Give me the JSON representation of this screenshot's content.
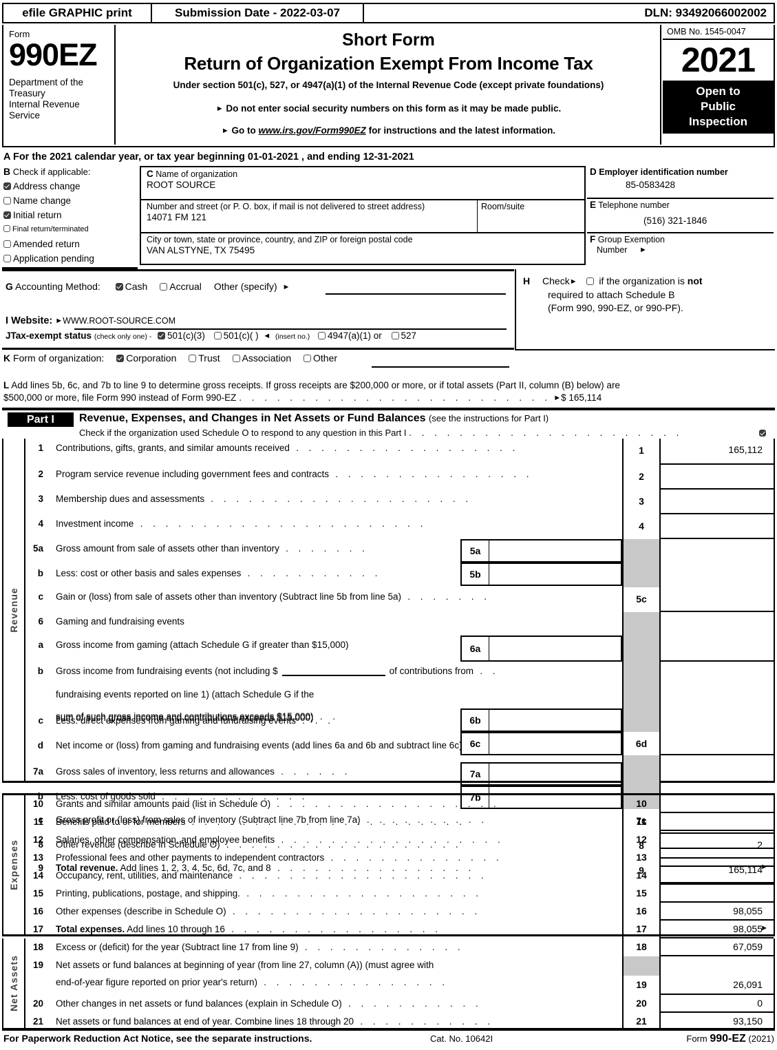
{
  "topbar": {
    "efile_label": "efile GRAPHIC print",
    "submission_label": "Submission Date - 2022-03-07",
    "dln_label": "DLN: 93492066002002"
  },
  "masthead": {
    "form_word": "Form",
    "form_number": "990EZ",
    "agency": "Department of the\nTreasury\nInternal Revenue\nService",
    "title": "Short Form",
    "subtitle": "Return of Organization Exempt From Income Tax",
    "under_section": "Under section 501(c), 527, or 4947(a)(1) of the Internal Revenue Code (except private foundations)",
    "note1": "Do not enter social security numbers on this form as it may be made public.",
    "note2_pre": "Go to ",
    "note2_link": "www.irs.gov/Form990EZ",
    "note2_post": " for instructions and the latest information.",
    "omb": "OMB No. 1545-0047",
    "year": "2021",
    "open_to": "Open to\nPublic\nInspection"
  },
  "line_a": "A  For the 2021 calendar year, or tax year beginning 01-01-2021 , and ending 12-31-2021",
  "section_b": {
    "key": "B",
    "title": "Check if applicable:",
    "options": [
      {
        "label": "Address change",
        "checked": true,
        "small": false
      },
      {
        "label": "Name change",
        "checked": false,
        "small": false
      },
      {
        "label": "Initial return",
        "checked": true,
        "small": false
      },
      {
        "label": "Final return/terminated",
        "checked": false,
        "small": true
      },
      {
        "label": "Amended return",
        "checked": false,
        "small": false
      },
      {
        "label": "Application pending",
        "checked": false,
        "small": false
      }
    ]
  },
  "section_c": {
    "key": "C",
    "name_label": "Name of organization",
    "name_value": "ROOT SOURCE",
    "street_label": "Number and street (or P. O. box, if mail is not delivered to street address)",
    "street_value": "14071 FM 121",
    "room_label": "Room/suite",
    "room_value": "",
    "city_label": "City or town, state or province, country, and ZIP or foreign postal code",
    "city_value": "VAN ALSTYNE, TX  75495"
  },
  "section_d": {
    "key": "D",
    "label": "Employer identification number",
    "value": "85-0583428"
  },
  "section_e": {
    "key": "E",
    "label": "Telephone number",
    "value": "(516) 321-1846"
  },
  "section_f": {
    "key": "F",
    "label": "Group Exemption",
    "label2": "Number",
    "value": ""
  },
  "section_g": {
    "key": "G",
    "label": "Accounting Method:",
    "cash": "Cash",
    "cash_checked": true,
    "accrual": "Accrual",
    "accrual_checked": false,
    "other": "Other (specify)",
    "other_value": ""
  },
  "section_h": {
    "key": "H",
    "line1_pre": "Check",
    "line1_post": "if the organization is",
    "line1_bold": "not",
    "checked": false,
    "line2": "required to attach Schedule B",
    "line3": "(Form 990, 990-EZ, or 990-PF)."
  },
  "section_i": {
    "key": "I",
    "label": "Website:",
    "value": "WWW.ROOT-SOURCE.COM"
  },
  "section_j": {
    "key": "J",
    "label": "Tax-exempt status",
    "note": "(check only one) -",
    "opt1": "501(c)(3)",
    "opt1_checked": true,
    "opt2": "501(c)(    )",
    "opt2_checked": false,
    "insert": "(insert no.)",
    "opt3": "4947(a)(1) or",
    "opt3_checked": false,
    "opt4": "527",
    "opt4_checked": false
  },
  "section_k": {
    "key": "K",
    "label": "Form of organization:",
    "options": [
      {
        "label": "Corporation",
        "checked": true
      },
      {
        "label": "Trust",
        "checked": false
      },
      {
        "label": "Association",
        "checked": false
      },
      {
        "label": "Other",
        "checked": false
      }
    ]
  },
  "section_l": {
    "key": "L",
    "text1": "Add lines 5b, 6c, and 7b to line 9 to determine gross receipts. If gross receipts are $200,000 or more, or if total assets (Part II, column (B) below) are",
    "text2": "$500,000 or more, file Form 990 instead of Form 990-EZ",
    "amount": "$ 165,114"
  },
  "part1": {
    "tag": "Part I",
    "title": "Revenue, Expenses, and Changes in Net Assets or Fund Balances",
    "title_note": "(see the instructions for Part I)",
    "subtitle": "Check if the organization used Schedule O to respond to any question in this Part I",
    "sub_checked": true
  },
  "revenue": {
    "side_label": "Revenue",
    "rows": [
      {
        "num": "1",
        "desc": "Contributions, gifts, grants, and similar amounts received",
        "dots": 18,
        "line": "1",
        "amount": "165,112"
      },
      {
        "num": "2",
        "desc": "Program service revenue including government fees and contracts",
        "dots": 16,
        "line": "2",
        "amount": ""
      },
      {
        "num": "3",
        "desc": "Membership dues and assessments",
        "dots": 21,
        "line": "3",
        "amount": ""
      },
      {
        "num": "4",
        "desc": "Investment income",
        "dots": 23,
        "line": "4",
        "amount": ""
      },
      {
        "num": "5a",
        "desc": "Gross amount from sale of assets other than inventory",
        "dots": 7,
        "sub": "5a",
        "amount": ""
      },
      {
        "num": "b",
        "desc": "Less: cost or other basis and sales expenses",
        "dots": 11,
        "sub": "5b",
        "amount": ""
      },
      {
        "num": "c",
        "desc": "Gain or (loss) from sale of assets other than inventory (Subtract line 5b from line 5a)",
        "dots": 7,
        "line": "5c",
        "amount": ""
      },
      {
        "num": "6",
        "desc": "Gaming and fundraising events",
        "dots": 0,
        "amount": ""
      },
      {
        "num": "a",
        "desc": "Gross income from gaming (attach Schedule G if greater than $15,000)",
        "dots": 0,
        "sub": "6a",
        "amount": ""
      },
      {
        "num": "b",
        "desc": "Gross income from fundraising events (not including $",
        "desc2": "of contributions from",
        "desc3": "fundraising events reported on line 1) (attach Schedule G if the",
        "desc4": "sum of such gross income and contributions exceeds $15,000)",
        "dots": 2,
        "sub": "6b",
        "amount": ""
      },
      {
        "num": "c",
        "desc": "Less: direct expenses from gaming and fundraising events",
        "dots": 3,
        "sub": "6c",
        "amount": ""
      },
      {
        "num": "d",
        "desc": "Net income or (loss) from gaming and fundraising events (add lines 6a and 6b and subtract line 6c)",
        "dots": 0,
        "line": "6d",
        "amount": ""
      },
      {
        "num": "7a",
        "desc": "Gross sales of inventory, less returns and allowances",
        "dots": 6,
        "sub": "7a",
        "amount": ""
      },
      {
        "num": "b",
        "desc": "Less: cost of goods sold",
        "dots": 12,
        "sub": "7b",
        "amount": ""
      },
      {
        "num": "c",
        "desc": "Gross profit or (loss) from sales of inventory (Subtract line 7b from line 7a)",
        "dots": 10,
        "line": "7c",
        "amount": ""
      },
      {
        "num": "8",
        "desc": "Other revenue (describe in Schedule O)",
        "dots": 19,
        "line": "8",
        "amount": "2"
      },
      {
        "num": "9",
        "desc_bold": "Total revenue.",
        "desc": " Add lines 1, 2, 3, 4, 5c, 6d, 7c, and 8",
        "dots": 16,
        "arrow": true,
        "line": "9",
        "amount": "165,114"
      }
    ]
  },
  "expenses": {
    "side_label": "Expenses",
    "rows": [
      {
        "num": "10",
        "desc": "Grants and similar amounts paid (list in Schedule O)",
        "dots": 18,
        "line": "10",
        "amount": ""
      },
      {
        "num": "11",
        "desc": "Benefits paid to or for members",
        "dots": 22,
        "line": "11",
        "amount": ""
      },
      {
        "num": "12",
        "desc": "Salaries, other compensation, and employee benefits",
        "dots": 18,
        "line": "12",
        "amount": ""
      },
      {
        "num": "13",
        "desc": "Professional fees and other payments to independent contractors",
        "dots": 14,
        "line": "13",
        "amount": ""
      },
      {
        "num": "14",
        "desc": "Occupancy, rent, utilities, and maintenance",
        "dots": 20,
        "line": "14",
        "amount": ""
      },
      {
        "num": "15",
        "desc": "Printing, publications, postage, and shipping.",
        "dots": 19,
        "line": "15",
        "amount": ""
      },
      {
        "num": "16",
        "desc": "Other expenses (describe in Schedule O)",
        "dots": 20,
        "line": "16",
        "amount": "98,055"
      },
      {
        "num": "17",
        "desc_bold": "Total expenses.",
        "desc": " Add lines 10 through 16",
        "dots": 17,
        "arrow": true,
        "line": "17",
        "amount": "98,055"
      }
    ]
  },
  "netassets": {
    "side_label": "Net Assets",
    "rows": [
      {
        "num": "18",
        "desc": "Excess or (deficit) for the year (Subtract line 17 from line 9)",
        "dots": 13,
        "line": "18",
        "amount": "67,059"
      },
      {
        "num": "19",
        "desc": "Net assets or fund balances at beginning of year (from line 27, column (A)) (must agree with",
        "desc2": "end-of-year figure reported on prior year's return)",
        "dots": 15,
        "line": "19",
        "amount": "26,091",
        "gray_top": true
      },
      {
        "num": "20",
        "desc": "Other changes in net assets or fund balances (explain in Schedule O)",
        "dots": 11,
        "line": "20",
        "amount": "0"
      },
      {
        "num": "21",
        "desc": "Net assets or fund balances at end of year. Combine lines 18 through 20",
        "dots": 11,
        "line": "21",
        "amount": "93,150"
      }
    ]
  },
  "footer": {
    "left": "For Paperwork Reduction Act Notice, see the separate instructions.",
    "cat": "Cat. No. 10642I",
    "right_pre": "Form ",
    "right_bold": "990-EZ",
    "right_post": " (2021)"
  }
}
